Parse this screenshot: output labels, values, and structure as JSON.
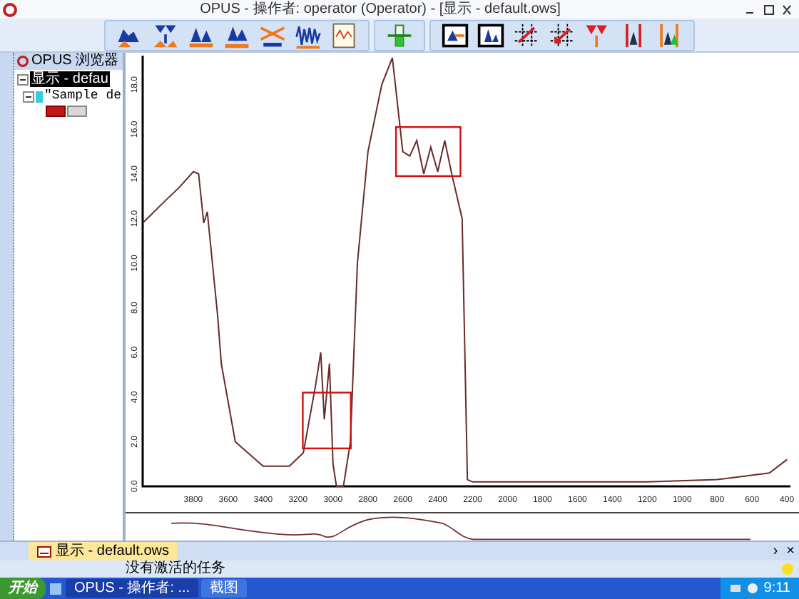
{
  "window": {
    "title": "OPUS - 操作者: operator  (Operator) - [显示 - default.ows]"
  },
  "browser": {
    "title": "OPUS 浏览器",
    "tree": [
      {
        "label": "显示 - defau",
        "selected": true,
        "expanded": true,
        "children": [
          {
            "label": "\"Sample de",
            "selected": false,
            "expanded": true
          }
        ]
      }
    ]
  },
  "spectrum": {
    "chart_data": {
      "type": "line",
      "xlim": [
        4090,
        380
      ],
      "ylim": [
        0,
        19.3
      ],
      "xticks": [
        3800,
        3600,
        3400,
        3200,
        3000,
        2800,
        2600,
        2400,
        2200,
        2000,
        1800,
        1600,
        1400,
        1200,
        1000,
        800,
        600,
        400
      ],
      "yticks": [
        {
          "value": 0,
          "label": "0.0"
        },
        {
          "value": 2,
          "label": "2.0"
        },
        {
          "value": 4,
          "label": "4.0"
        },
        {
          "value": 6,
          "label": "6.0"
        },
        {
          "value": 8,
          "label": "8.0"
        },
        {
          "value": 10,
          "label": "10.0"
        },
        {
          "value": 12,
          "label": "12.0"
        },
        {
          "value": 14,
          "label": "14.0"
        },
        {
          "value": 16,
          "label": "16.0"
        },
        {
          "value": 18,
          "label": "18.0"
        }
      ],
      "x": [
        4090,
        3960,
        3880,
        3800,
        3770,
        3740,
        3720,
        3660,
        3640,
        3560,
        3400,
        3250,
        3170,
        3100,
        3070,
        3050,
        3020,
        3000,
        2980,
        2940,
        2900,
        2860,
        2800,
        2720,
        2660,
        2600,
        2560,
        2520,
        2480,
        2440,
        2400,
        2360,
        2320,
        2260,
        2230,
        2200,
        1800,
        1200,
        800,
        500,
        400
      ],
      "series": [
        {
          "color": "#6b2a2a",
          "values": [
            11.8,
            12.8,
            13.4,
            14.1,
            14.0,
            11.8,
            12.3,
            7.6,
            5.5,
            2.0,
            0.9,
            0.9,
            1.5,
            4.5,
            6.0,
            3.0,
            5.5,
            1.0,
            0.0,
            0.0,
            2.0,
            10.0,
            15.0,
            18.0,
            19.2,
            15.0,
            14.8,
            15.5,
            14.0,
            15.2,
            14.1,
            15.5,
            14.0,
            12.0,
            0.3,
            0.2,
            0.2,
            0.2,
            0.3,
            0.6,
            1.2
          ]
        }
      ]
    }
  },
  "tabs": [
    {
      "label": "显示 - default.ows",
      "selected": true
    }
  ],
  "tab_bar": {
    "scroll": "›",
    "close": "×"
  },
  "status_bar": {
    "text": "没有激活的任务"
  },
  "taskbar": {
    "start": "开始",
    "tasks": [
      {
        "label": "OPUS - 操作者: ...",
        "selected": true
      },
      {
        "label": "截图",
        "selected": false
      }
    ],
    "clock": "9:11"
  }
}
